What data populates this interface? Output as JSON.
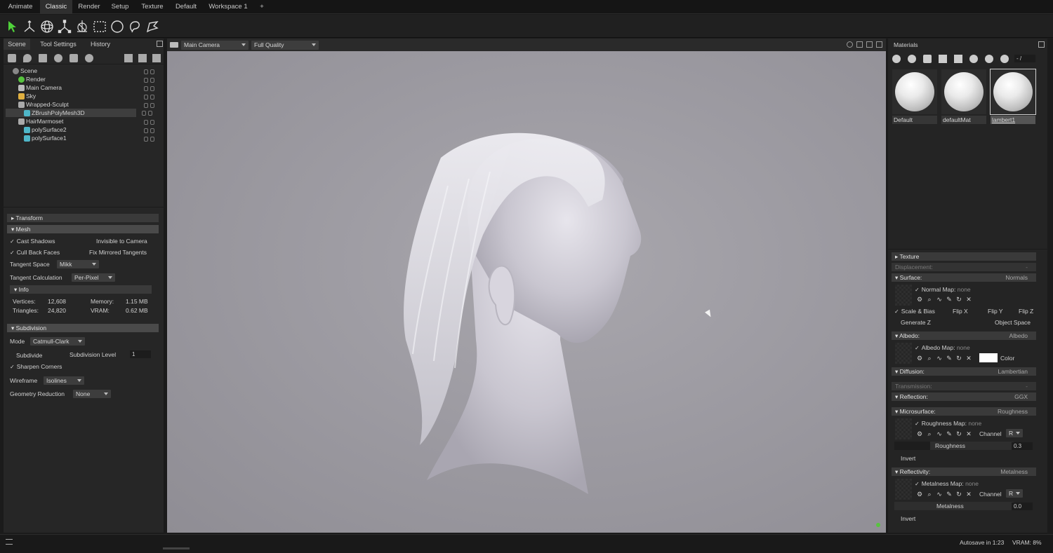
{
  "menubar": {
    "tabs": [
      "Animate",
      "Classic",
      "Render",
      "Setup",
      "Texture",
      "Default",
      "Workspace 1",
      "+"
    ],
    "active": 1
  },
  "toolbar": {
    "tools": [
      "select-arrow-icon",
      "move-gizmo-icon",
      "rotate-gizmo-icon",
      "scale-gizmo-icon",
      "transform-gizmo-icon",
      "rect-select-icon",
      "circle-select-icon",
      "lasso-select-icon",
      "paint-select-icon"
    ]
  },
  "left_panel": {
    "tabs": [
      "Scene",
      "Tool Settings",
      "History"
    ],
    "tree": [
      {
        "label": "Scene",
        "indent": 0
      },
      {
        "label": "Render",
        "indent": 1
      },
      {
        "label": "Main Camera",
        "indent": 1
      },
      {
        "label": "Sky",
        "indent": 1
      },
      {
        "label": "Wrapped-Sculpt",
        "indent": 1
      },
      {
        "label": "ZBrushPolyMesh3D",
        "indent": 2,
        "selected": true
      },
      {
        "label": "HairMarmoset",
        "indent": 1
      },
      {
        "label": "polySurface2",
        "indent": 2
      },
      {
        "label": "polySurface1",
        "indent": 2
      }
    ],
    "transform_label": "Transform",
    "mesh_label": "Mesh",
    "cast_shadows": "Cast Shadows",
    "invisible_to_camera": "Invisible to Camera",
    "cull_back_faces": "Cull Back Faces",
    "fix_mirrored_tangents": "Fix Mirrored Tangents",
    "tangent_space_label": "Tangent Space",
    "tangent_space_value": "Mikk",
    "tangent_calc_label": "Tangent Calculation",
    "tangent_calc_value": "Per-Pixel",
    "info_label": "Info",
    "vertices_label": "Vertices:",
    "vertices_value": "12,608",
    "triangles_label": "Triangles:",
    "triangles_value": "24,820",
    "memory_label": "Memory:",
    "memory_value": "1.15 MB",
    "vram_label": "VRAM:",
    "vram_value": "0.62 MB",
    "subdivision_label": "Subdivision",
    "mode_label": "Mode",
    "mode_value": "Catmull-Clark",
    "subdivide_label": "Subdivide",
    "subdivision_level_label": "Subdivision Level",
    "subdivision_level_value": "1",
    "sharpen_corners": "Sharpen Corners",
    "wireframe_label": "Wireframe",
    "wireframe_value": "Isolines",
    "geometry_reduction_label": "Geometry Reduction",
    "geometry_reduction_value": "None"
  },
  "viewport": {
    "camera": "Main Camera",
    "quality": "Full Quality"
  },
  "right_panel": {
    "title": "Materials",
    "search": "- /",
    "materials": [
      "Default",
      "defaultMat",
      "lambert1"
    ],
    "selected_material": 2,
    "texture": "Texture",
    "displacement": "Displacement:",
    "displacement_value": "-",
    "surface": "Surface:",
    "surface_value": "Normals",
    "normal_map": "Normal Map:",
    "none": "none",
    "scale_bias": "Scale & Bias",
    "flip_x": "Flip X",
    "flip_y": "Flip Y",
    "flip_z": "Flip Z",
    "generate_z": "Generate Z",
    "object_space": "Object Space",
    "albedo": "Albedo:",
    "albedo_value": "Albedo",
    "albedo_map": "Albedo Map:",
    "color_label": "Color",
    "albedo_color": "#ffffff",
    "diffusion": "Diffusion:",
    "diffusion_value": "Lambertian",
    "transmission": "Transmission:",
    "transmission_value": "-",
    "reflection": "Reflection:",
    "reflection_value": "GGX",
    "microsurface": "Microsurface:",
    "microsurface_value": "Roughness",
    "roughness_map": "Roughness Map:",
    "channel_label": "Channel",
    "channel_value": "R",
    "roughness_label": "Roughness",
    "roughness_value": "0.3",
    "invert": "Invert",
    "reflectivity": "Reflectivity:",
    "reflectivity_value": "Metalness",
    "metalness_map": "Metalness Map:",
    "metalness_label": "Metalness",
    "metalness_value": "0.0"
  },
  "status": {
    "autosave": "Autosave in 1:23",
    "vram": "VRAM: 8%"
  }
}
